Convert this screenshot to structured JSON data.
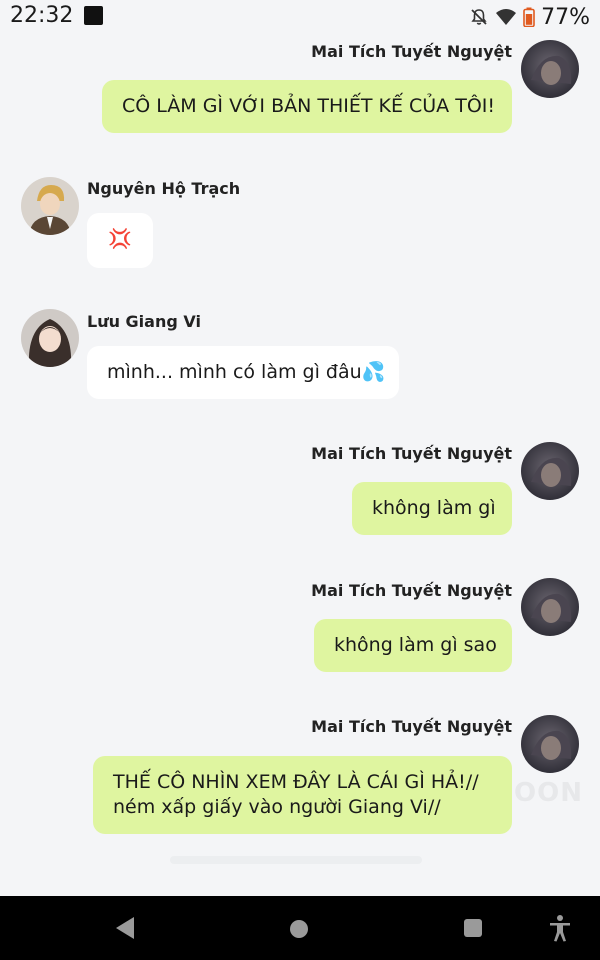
{
  "status_bar": {
    "time": "22:32",
    "battery_percent": "77%",
    "icons": [
      "notifications-muted-icon",
      "wifi-icon",
      "battery-icon"
    ]
  },
  "messages": [
    {
      "sender": "Mai Tích Tuyết Nguyệt",
      "side": "right",
      "lines": [
        "CÔ LÀM GÌ VỚI BẢN THIẾT KẾ CỦA TÔI!"
      ]
    },
    {
      "sender": "Nguyên Hộ Trạch",
      "side": "left",
      "lines": [
        "💢"
      ]
    },
    {
      "sender": "Lưu Giang Vi",
      "side": "left",
      "lines": [
        "mình... mình có làm gì đâu💦"
      ]
    },
    {
      "sender": "Mai Tích Tuyết Nguyệt",
      "side": "right",
      "lines": [
        "không làm gì"
      ]
    },
    {
      "sender": "Mai Tích Tuyết Nguyệt",
      "side": "right",
      "lines": [
        "không làm gì sao"
      ]
    },
    {
      "sender": "Mai Tích Tuyết Nguyệt",
      "side": "right",
      "lines": [
        "THẾ CÔ NHÌN XEM ĐÂY LÀ CÁI GÌ HẢ!//",
        "ném xấp giấy vào người Giang Vi//"
      ]
    }
  ],
  "watermark": "OON",
  "colors": {
    "own_bubble": "#dff5a0",
    "other_bubble": "#ffffff",
    "background": "#f4f5f7",
    "nav_bar": "#000000"
  },
  "nav_bar": {
    "buttons": [
      "back-icon",
      "home-icon",
      "recents-icon",
      "accessibility-icon"
    ]
  }
}
